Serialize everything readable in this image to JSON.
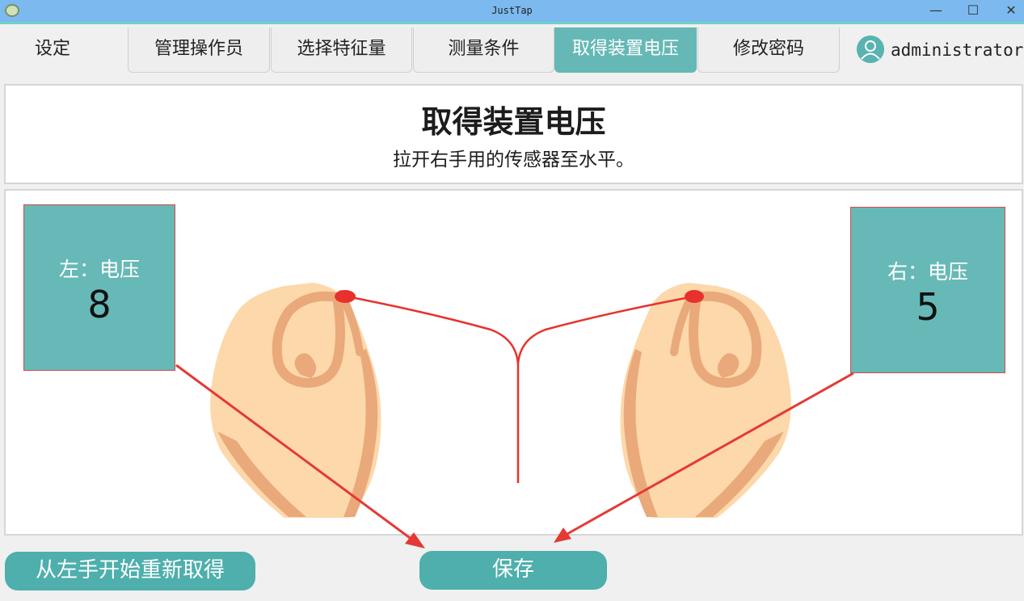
{
  "window": {
    "title": "JustTap",
    "minimize_glyph": "—",
    "maximize_glyph": "☐",
    "close_glyph": "✕"
  },
  "tabs": [
    {
      "label": "设定",
      "active": false
    },
    {
      "label": "管理操作员",
      "active": false
    },
    {
      "label": "选择特征量",
      "active": false
    },
    {
      "label": "测量条件",
      "active": false
    },
    {
      "label": "取得装置电压",
      "active": true
    },
    {
      "label": "修改密码",
      "active": false
    }
  ],
  "user": {
    "name": "administrator",
    "icon": "user-avatar-icon"
  },
  "header": {
    "title": "取得装置电压",
    "subtitle": "拉开右手用的传感器至水平。"
  },
  "voltage": {
    "left": {
      "label": "左：电压",
      "value": "8"
    },
    "right": {
      "label": "右：电压",
      "value": "5"
    }
  },
  "buttons": {
    "restart_label": "从左手开始重新取得",
    "save_label": "保存"
  },
  "colors": {
    "accent": "#66b8b6",
    "button": "#4eafac",
    "titlebar": "#7cb9ee",
    "annotation_arrow": "#e53935",
    "sensor": "#e8312c",
    "skin": "#fdd8aa",
    "skin_shadow": "#eaa97a"
  }
}
